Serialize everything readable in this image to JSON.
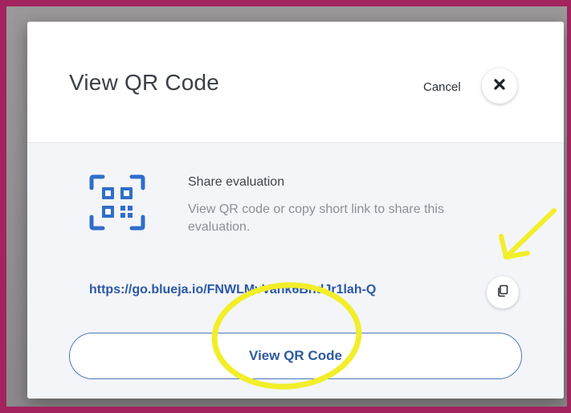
{
  "modal": {
    "title": "View QR Code",
    "cancel_label": "Cancel",
    "close_icon": "close-icon"
  },
  "share": {
    "title": "Share evaluation",
    "description": "View QR code or copy short link to share this evaluation.",
    "icon": "qr-code-icon",
    "short_link": "https://go.blueja.io/FNWLMvVank6BndJr1lah-Q",
    "copy_icon": "copy-icon",
    "view_qr_button_label": "View QR Code"
  },
  "colors": {
    "frame_border": "#a3235f",
    "accent_blue": "#2b58a8",
    "button_border": "#4b79bf",
    "annotation_yellow": "#f2ee2a"
  }
}
